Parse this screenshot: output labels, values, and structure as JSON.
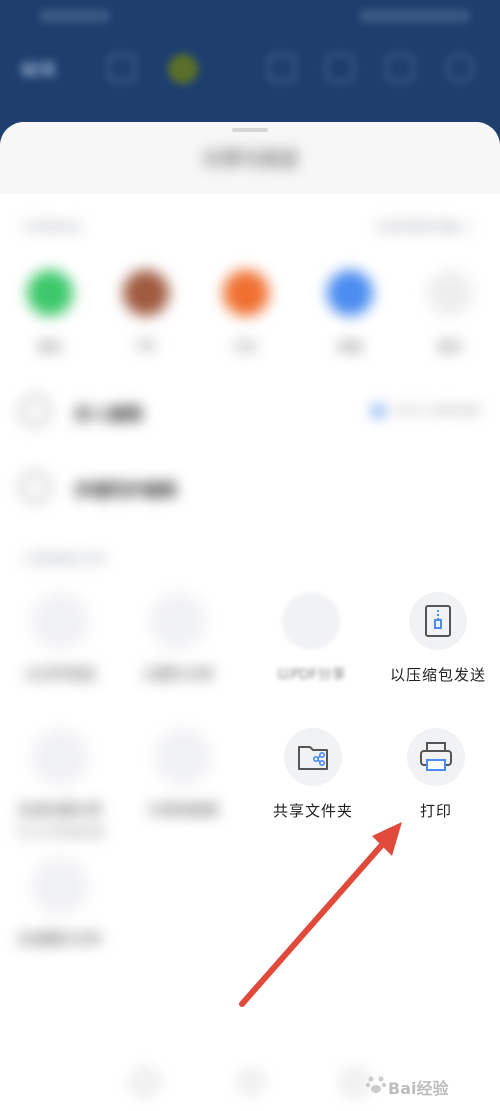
{
  "sheet": {
    "title": "分享与发送",
    "recent_section": {
      "label": "分享给好友",
      "action": "发送到我的电脑 >"
    },
    "contacts": [
      {
        "label": "微信",
        "color": "#3cc86a"
      },
      {
        "label": "QQ",
        "color": "#a05a40"
      },
      {
        "label": "钉钉",
        "color": "#f07030"
      },
      {
        "label": "邮箱",
        "color": "#4a8cf0"
      },
      {
        "label": "更多",
        "color": "#eeeeee"
      }
    ],
    "rows": [
      {
        "label": "多人编辑",
        "extra": "允许他人查看和编辑"
      },
      {
        "label": "多端同步编辑",
        "extra": ""
      }
    ],
    "file_section": {
      "label": "以其他格式分享"
    },
    "tiles": [
      {
        "label": "以文件发送",
        "sub": "",
        "icon": "file-icon",
        "dim": false
      },
      {
        "label": "以图片分享",
        "sub": "",
        "icon": "image-icon",
        "dim": false
      },
      {
        "label": "以PDF分享",
        "sub": "",
        "icon": "pdf-icon",
        "dim": true
      },
      {
        "label": "以压缩包发送",
        "sub": "",
        "icon": "zip-icon",
        "dim": false
      },
      {
        "label": "生成长图分享",
        "sub": "可以分享到朋友圈",
        "icon": "longimage-icon",
        "dim": false
      },
      {
        "label": "分享到视频",
        "sub": "",
        "icon": "video-icon",
        "dim": false
      },
      {
        "label": "共享文件夹",
        "sub": "",
        "icon": "shared-folder-icon",
        "dim": false
      },
      {
        "label": "打印",
        "sub": "",
        "icon": "printer-icon",
        "dim": false
      },
      {
        "label": "生成图片文件",
        "sub": "",
        "icon": "doc-icon",
        "dim": false
      }
    ]
  },
  "topbar": {
    "title": "编辑"
  },
  "watermark": {
    "text": "Bai经验"
  },
  "colors": {
    "arrow": "#e04a3a",
    "accent": "#4a8cf0",
    "header_blue": "#1e3f6e"
  }
}
